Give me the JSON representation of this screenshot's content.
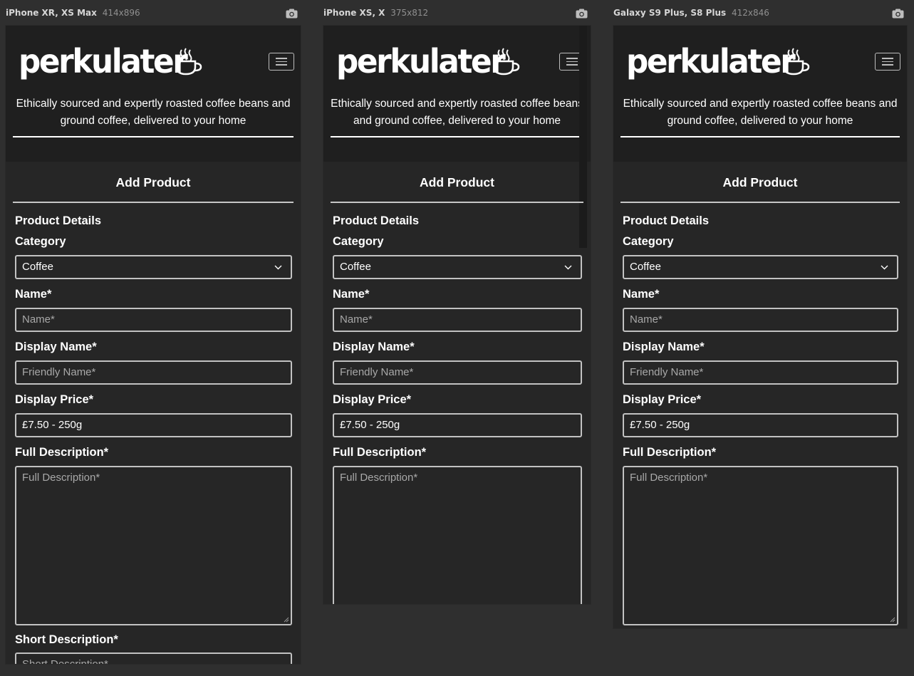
{
  "devices": [
    {
      "name": "iPhone XR, XS Max",
      "dims": "414x896"
    },
    {
      "name": "iPhone XS, X",
      "dims": "375x812"
    },
    {
      "name": "Galaxy S9 Plus, S8 Plus",
      "dims": "412x846"
    }
  ],
  "site": {
    "logo_text": "perkulater",
    "tagline": "Ethically sourced and expertly roasted coffee beans and ground coffee, delivered to your home"
  },
  "form": {
    "title": "Add Product",
    "section": "Product Details",
    "category_label": "Category",
    "category_value": "Coffee",
    "name_label": "Name*",
    "name_placeholder": "Name*",
    "display_name_label": "Display Name*",
    "display_name_placeholder": "Friendly Name*",
    "display_price_label": "Display Price*",
    "display_price_value": "£7.50 - 250g",
    "full_desc_label": "Full Description*",
    "full_desc_placeholder": "Full Description*",
    "short_desc_label": "Short Description*",
    "short_desc_placeholder": "Short Description*"
  },
  "icons": {
    "device_action": "camera-icon",
    "menu": "hamburger-menu-icon",
    "logo_mark": "steaming-cup-icon",
    "select": "chevron-down-icon"
  }
}
